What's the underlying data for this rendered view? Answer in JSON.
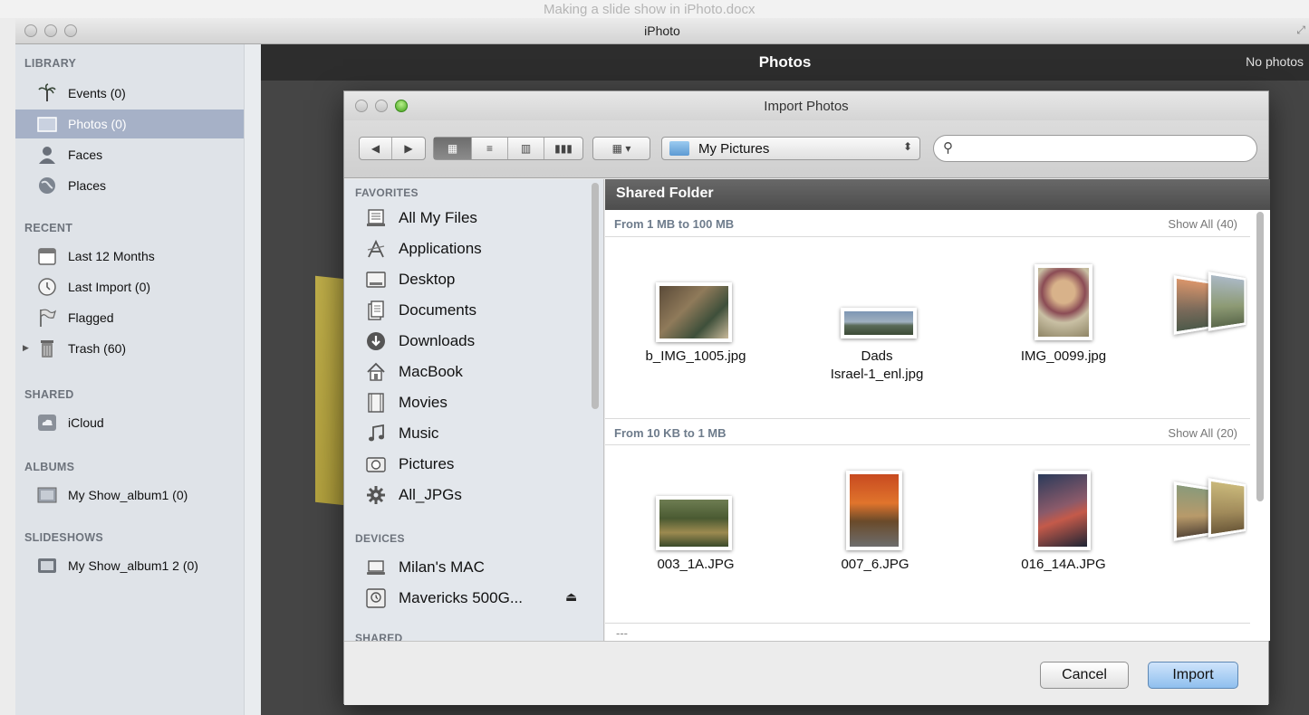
{
  "background_doc": {
    "title": "Making a slide show in iPhoto.docx"
  },
  "window": {
    "title": "iPhoto"
  },
  "sidebar": {
    "sections": {
      "library": "LIBRARY",
      "recent": "RECENT",
      "shared": "SHARED",
      "albums": "ALBUMS",
      "slideshows": "SLIDESHOWS"
    },
    "items": {
      "events": "Events (0)",
      "photos": "Photos (0)",
      "faces": "Faces",
      "places": "Places",
      "last12": "Last 12 Months",
      "lastimport": "Last Import (0)",
      "flagged": "Flagged",
      "trash": "Trash (60)",
      "icloud": "iCloud",
      "album1": "My Show_album1 (0)",
      "slideshow1": "My Show_album1 2 (0)"
    }
  },
  "main": {
    "title": "Photos",
    "count": "No photos"
  },
  "dialog": {
    "title": "Import Photos",
    "location": "My Pictures",
    "sidebar": {
      "favorites_head": "FAVORITES",
      "devices_head": "DEVICES",
      "shared_head": "SHARED",
      "favorites": {
        "allfiles": "All My Files",
        "applications": "Applications",
        "desktop": "Desktop",
        "documents": "Documents",
        "downloads": "Downloads",
        "macbook": "MacBook",
        "movies": "Movies",
        "music": "Music",
        "pictures": "Pictures",
        "alljpgs": "All_JPGs"
      },
      "devices": {
        "milan": "Milan's MAC",
        "mavericks": "Mavericks 500G..."
      }
    },
    "content": {
      "folder": "Shared Folder",
      "group1": {
        "title": "From 1 MB to 100 MB",
        "show_all": "Show All (40)",
        "files": {
          "f1": "b_IMG_1005.jpg",
          "f2_line1": "Dads",
          "f2_line2": "Israel-1_enl.jpg",
          "f3": "IMG_0099.jpg"
        }
      },
      "group2": {
        "title": "From 10 KB to 1 MB",
        "show_all": "Show All (20)",
        "files": {
          "f1": "003_1A.JPG",
          "f2": "007_6.JPG",
          "f3": "016_14A.JPG"
        }
      },
      "group3_title": "---"
    },
    "buttons": {
      "cancel": "Cancel",
      "import": "Import"
    }
  },
  "colors": {
    "selection": "#a6b1c7",
    "sidebar_bg": "#dfe3e8",
    "primary_button": "#8fbfee",
    "dark_header": "#2d2d2d"
  }
}
